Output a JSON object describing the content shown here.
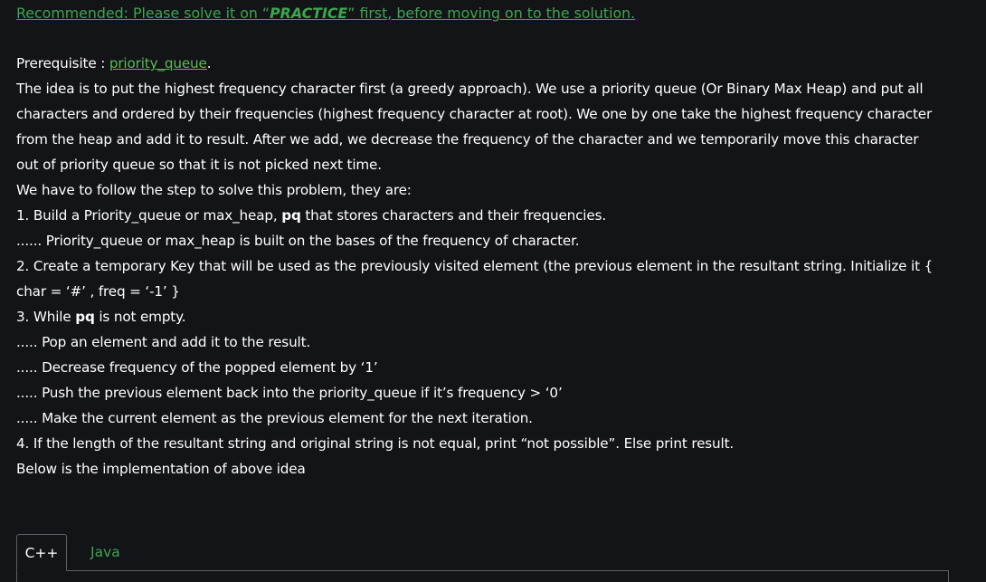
{
  "recommended": {
    "prefix": "Recommended: Please solve it on “",
    "practice": "PRACTICE",
    "suffix": "” first, before moving on to the solution."
  },
  "prerequisite": {
    "label": "Prerequisite : ",
    "link": "priority_queue",
    "end": "."
  },
  "idea_lines": [
    "The idea is to put the highest frequency character first (a greedy approach). We use a priority queue (Or Binary Max Heap) and put all",
    "characters and ordered by their frequencies (highest frequency character at root). We one by one take the highest frequency character",
    "from the heap and add it to result. After we add, we decrease the frequency of the character and we temporarily move this character",
    "out of priority queue so that it is not picked next time."
  ],
  "steps_intro": "We have to follow the step to solve this problem, they are:",
  "step1": {
    "before": "1. Build a Priority_queue or max_heap, ",
    "bold": "pq",
    "after": " that stores characters and their frequencies."
  },
  "step1_sub": "...... Priority_queue or max_heap is built on the bases of the frequency of character.",
  "step2_line1": "2. Create a temporary Key that will be used as the previously visited element (the previous element in the resultant string. Initialize it {",
  "step2_line2": "char = ‘#’ , freq = ‘-1’ }",
  "step3": {
    "before": "3. While ",
    "bold": "pq",
    "after": " is not empty."
  },
  "step3_subs": [
    "..... Pop an element and add it to the result.",
    "..... Decrease frequency of the popped element by ‘1’",
    "..... Push the previous element back into the priority_queue if it’s frequency > ‘0’",
    "..... Make the current element as the previous element for the next iteration."
  ],
  "step4": "4. If the length of the resultant string and original string is not equal, print “not possible”. Else print result.",
  "closing": "Below is the implementation of above idea",
  "tabs": [
    {
      "label": "C++",
      "active": true
    },
    {
      "label": "Java",
      "active": false
    }
  ],
  "colors": {
    "background": "#131417",
    "link_green": "#3ba64f",
    "text": "#ffffff",
    "border": "#5d6066"
  }
}
